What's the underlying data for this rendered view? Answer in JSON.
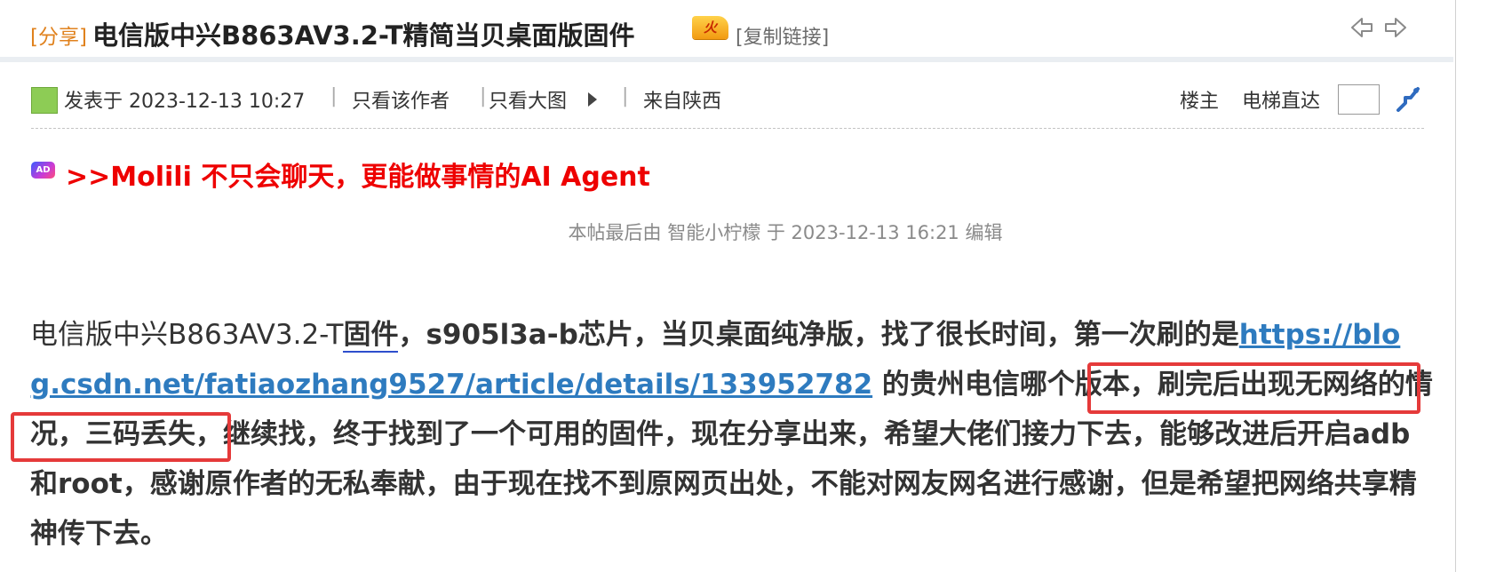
{
  "thread": {
    "tag": "[分享]",
    "title": "电信版中兴B863AV3.2-T精简当贝桌面版固件",
    "hot_badge": "火",
    "copy_link": "[复制链接]"
  },
  "meta": {
    "posted": "发表于 2023-12-13 10:27",
    "separator": "|",
    "only_author": "只看该作者",
    "only_large_image": "只看大图",
    "from": "来自陕西",
    "floor": "楼主",
    "elevator": "电梯直达"
  },
  "ad": {
    "icon": "AD",
    "text": ">>Molili 不只会聊天，更能做事情的AI Agent"
  },
  "edited_note": "本帖最后由 智能小柠檬 于 2023-12-13 16:21 编辑",
  "post": {
    "p1": "电信版中兴B863AV3.2-T",
    "keyword": "固件",
    "p2": "，s905l3a-b芯片，当贝桌面纯净版，找了很长时间，第一次刷的是",
    "link_part1": "https://blo",
    "link_part2": "g.csdn.net/fatiaozhang9527/article/details/133952782",
    "p3": " 的贵州电信哪个版本，",
    "highlight1": "刷完后出现无网络的情",
    "highlight2": "况，三码丢失，",
    "p4": "继续找，终于找到了一个可用的固件，现在分享出来，希望大佬们接力下去，能够改进后开启adb和root，感谢原作者的无私奉献，由于现在找不到原网页出处，不能对网友网名进行感谢，但是希望把网络共享精神传下去。"
  },
  "colors": {
    "tag": "#e0821e",
    "ad_text": "#ee0000",
    "link": "#2e7bbf",
    "annotation_box": "#e53a3a"
  },
  "icons": [
    "arrow-left-icon",
    "arrow-right-icon",
    "avatar-icon",
    "play-icon",
    "jump-icon",
    "ad-icon",
    "hot-badge-icon"
  ]
}
